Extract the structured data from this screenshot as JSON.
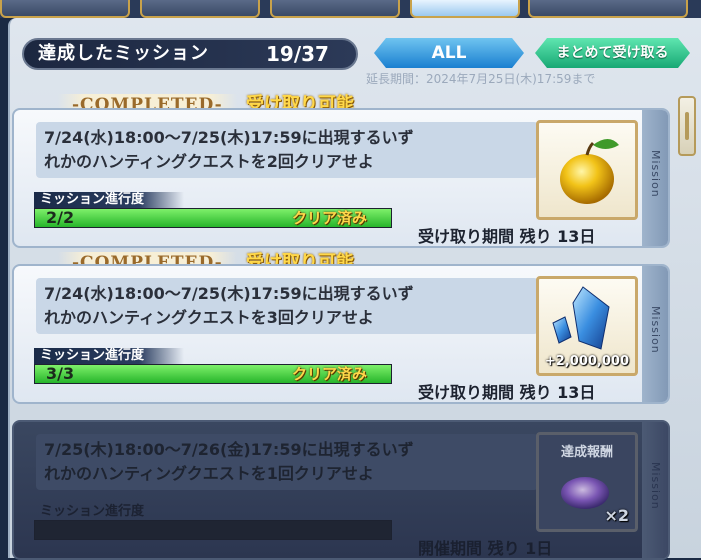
{
  "header": {
    "title": "達成したミッション",
    "count": "19/37",
    "all_button": "ALL",
    "collect_all_button": "まとめて受け取る",
    "background_text": "延長期間：2024年7月25日(木)17:59まで"
  },
  "missions": [
    {
      "status_banner": "-COMPLETED-",
      "claim_text": "受け取り可能",
      "description_line1": "7/24(水)18:00〜7/25(木)17:59に出現するいず",
      "description_line2": "れかのハンティングクエストを2回クリアせよ",
      "progress_label": "ミッション進行度",
      "progress_text": "2/2",
      "progress_fraction": 1.0,
      "cleared_text": "クリア済み",
      "reward_icon": "golden-apple-icon",
      "reward_qty": "",
      "reward_label": "",
      "expiry": "受け取り期間 残り 13日",
      "side_label": "Mission"
    },
    {
      "status_banner": "-COMPLETED-",
      "claim_text": "受け取り可能",
      "description_line1": "7/24(水)18:00〜7/25(木)17:59に出現するいず",
      "description_line2": "れかのハンティングクエストを3回クリアせよ",
      "progress_label": "ミッション進行度",
      "progress_text": "3/3",
      "progress_fraction": 1.0,
      "cleared_text": "クリア済み",
      "reward_icon": "blue-crystal-icon",
      "reward_qty": "+2,000,000",
      "reward_label": "",
      "expiry": "受け取り期間 残り 13日",
      "side_label": "Mission"
    },
    {
      "status_banner": "",
      "claim_text": "",
      "description_line1": "7/25(木)18:00〜7/26(金)17:59に出現するいず",
      "description_line2": "れかのハンティングクエストを1回クリアせよ",
      "progress_label": "ミッション進行度",
      "progress_text": "",
      "progress_fraction": 0,
      "cleared_text": "",
      "reward_icon": "purple-orb-icon",
      "reward_qty": "×2",
      "reward_label": "達成報酬",
      "expiry": "開催期間 残り 1日",
      "side_label": "Mission"
    }
  ],
  "colors": {
    "progress_fill": "#3ccf3a",
    "gold_text": "#ffd84a",
    "all_button": "#2a9be6",
    "collect_button": "#22c28a"
  }
}
